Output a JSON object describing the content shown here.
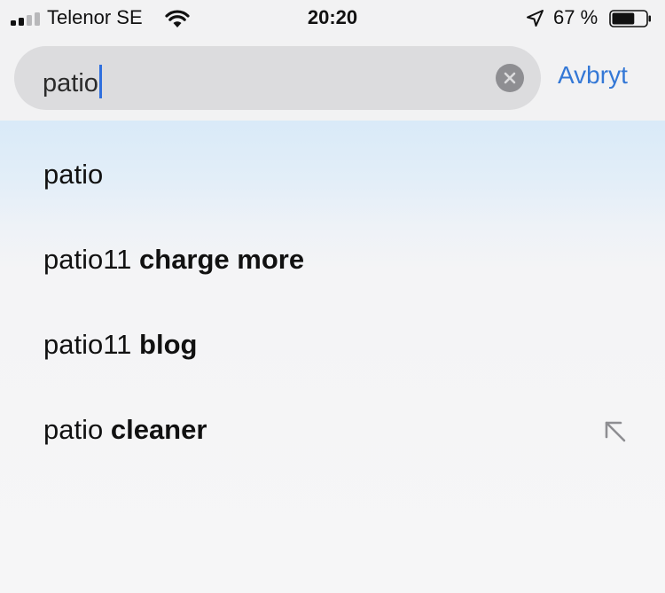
{
  "status_bar": {
    "carrier": "Telenor SE",
    "time": "20:20",
    "battery_percent": "67 %",
    "battery_level": 0.67,
    "signal_bars_filled": 2,
    "signal_bars_total": 4,
    "icons": {
      "wifi": "wifi-icon",
      "location": "location-arrow-icon",
      "battery": "battery-icon"
    }
  },
  "search": {
    "query": "patio",
    "clear_icon": "clear-icon",
    "cancel_label": "Avbryt"
  },
  "suggestions": [
    {
      "prefix": "patio",
      "completion": ""
    },
    {
      "prefix": "patio11",
      "completion": " charge more"
    },
    {
      "prefix": "patio11",
      "completion": " blog"
    },
    {
      "prefix": "patio",
      "completion": " cleaner"
    }
  ],
  "fill_icon": "arrow-up-left-icon",
  "colors": {
    "accent": "#3478d6",
    "caret": "#2f6fde",
    "search_field_bg": "#dcdcde",
    "highlight_row": "#d9eaf8"
  }
}
